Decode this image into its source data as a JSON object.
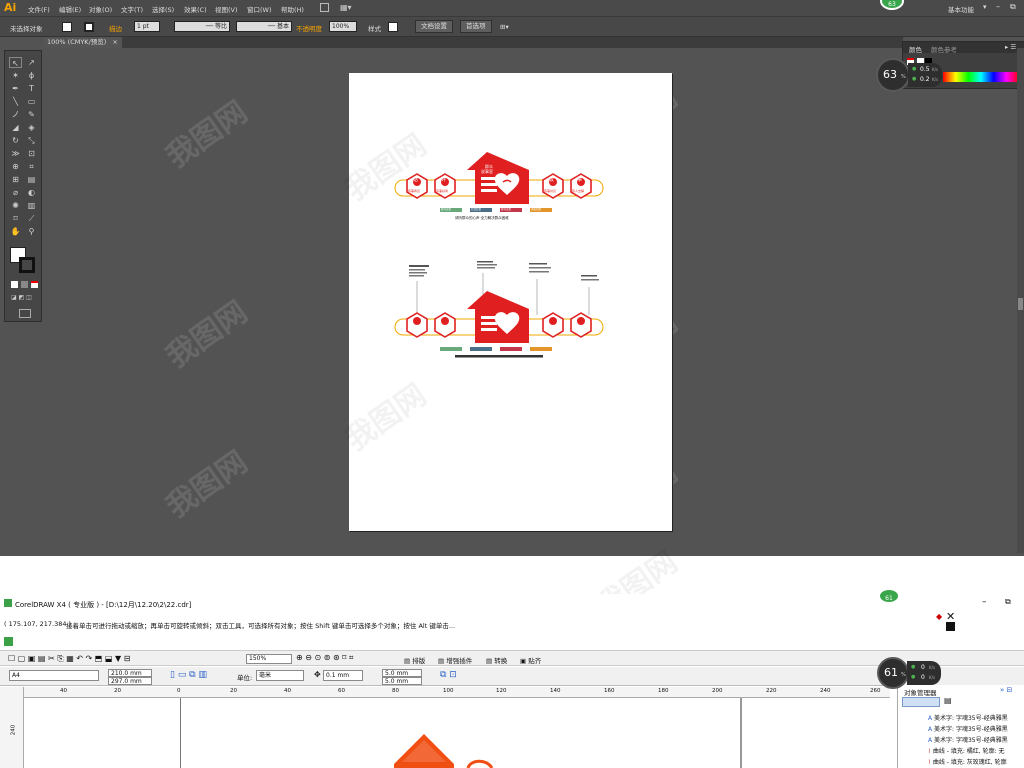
{
  "ai": {
    "logo": "Ai",
    "menu": [
      "文件(F)",
      "编辑(E)",
      "对象(O)",
      "文字(T)",
      "选择(S)",
      "效果(C)",
      "视图(V)",
      "窗口(W)",
      "帮助(H)"
    ],
    "workspace": "基本功能",
    "badge_top": "63",
    "control": {
      "selection": "未选择对象",
      "stroke_label": "描边",
      "stroke_value": "1 pt",
      "profile": "等比",
      "brush": "基本",
      "opacity_label": "不透明度",
      "opacity_value": "100%",
      "style_label": "样式",
      "doc_setup": "文档设置",
      "prefs": "首选项"
    },
    "doc_tab": "100% (CMYK/预览)",
    "panel": {
      "tab_color": "颜色",
      "tab_guide": "颜色参考"
    },
    "perf": {
      "percent": "63",
      "percent_suffix": "%",
      "up": "0.5",
      "down": "0.2",
      "unit": "K/s"
    },
    "artwork": {
      "house_line1": "群众",
      "house_line2": "说事室",
      "hexagons": [
        {
          "char": "话",
          "label": "有事商议"
        },
        {
          "char": "评",
          "label": "有事好商"
        },
        {
          "char": "议",
          "label": "有事共议"
        },
        {
          "char": "事",
          "label": "有人去解"
        }
      ],
      "tags": [
        "群众说事",
        "社情民意",
        "群众说事",
        "矛盾化解"
      ],
      "slogan": "倾听群众的心声 全力解决群众困难"
    }
  },
  "cd": {
    "title": "CorelDRAW X4 ( 专业版 ) - [D:\\12月\\12.20\\2\\22.cdr]",
    "coords": "( 175.107, 217.384 )",
    "hint": "接着单击可进行拖动或缩放；再单击可旋转或倾斜；双击工具，可选择所有对象；按住 Shift 键单击可选择多个对象；按住 Alt 键单击...",
    "badge_top": "61",
    "toolbar": {
      "zoom": "150%",
      "btn1": "排版",
      "btn2": "增强插件",
      "btn3": "转换",
      "btn4": "贴齐"
    },
    "prop": {
      "page": "A4",
      "width": "210.0 mm",
      "height": "297.0 mm",
      "unit_label": "单位:",
      "unit_value": "毫米",
      "nudge": "0.1 mm",
      "dup_x": "5.0 mm",
      "dup_y": "5.0 mm"
    },
    "ruler_marks": [
      "40",
      "20",
      "0",
      "20",
      "40",
      "60",
      "80",
      "100",
      "120",
      "140",
      "160",
      "180",
      "200",
      "220",
      "240",
      "260"
    ],
    "ruler_v": "240",
    "perf": {
      "percent": "61",
      "percent_suffix": "%",
      "up": "0",
      "down": "0",
      "unit": "K/s"
    },
    "objmgr": {
      "title": "对象管理器",
      "rows": [
        "美术字: 字魂35号-经典雅黑",
        "美术字: 字魂35号-经典雅黑",
        "美术字: 字魂35号-经典雅黑",
        "曲线 - 填充: 橘红, 轮廓: 无",
        "曲线 - 填充: 灰玫瑰红, 轮廓"
      ]
    }
  }
}
